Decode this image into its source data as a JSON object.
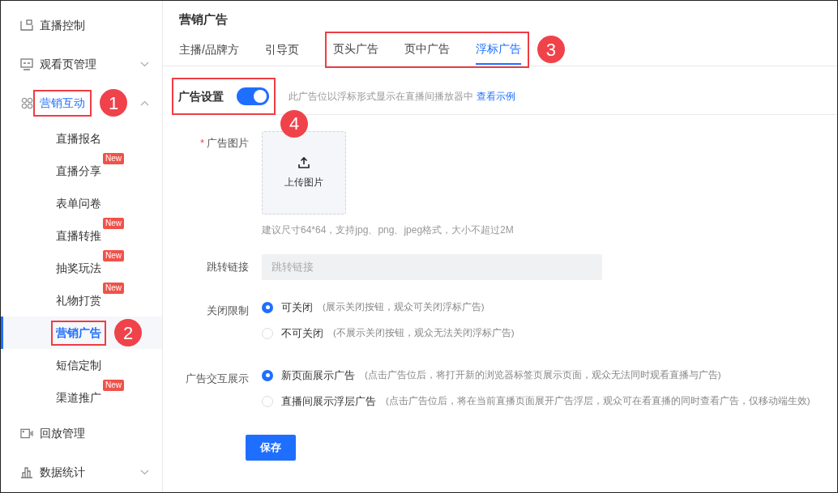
{
  "sidebar": {
    "items": [
      {
        "label": "直播控制",
        "selected": false
      },
      {
        "label": "观看页管理",
        "selected": false,
        "expanded": false
      },
      {
        "label": "营销互动",
        "selected": true,
        "expanded": true,
        "callout": "1",
        "children": [
          {
            "label": "直播报名",
            "selected": false
          },
          {
            "label": "直播分享",
            "selected": false,
            "badge": "New"
          },
          {
            "label": "表单问卷",
            "selected": false
          },
          {
            "label": "直播转推",
            "selected": false,
            "badge": "New"
          },
          {
            "label": "抽奖玩法",
            "selected": false,
            "badge": "New"
          },
          {
            "label": "礼物打赏",
            "selected": false,
            "badge": "New"
          },
          {
            "label": "营销广告",
            "selected": true,
            "callout": "2"
          },
          {
            "label": "短信定制",
            "selected": false
          },
          {
            "label": "渠道推广",
            "selected": false,
            "badge": "New"
          }
        ]
      },
      {
        "label": "回放管理",
        "selected": false
      },
      {
        "label": "数据统计",
        "selected": false,
        "expanded": false
      }
    ]
  },
  "page_title": "营销广告",
  "tabs": {
    "callout": "3",
    "items": [
      {
        "label": "主播/品牌方",
        "selected": false
      },
      {
        "label": "引导页",
        "selected": false
      },
      {
        "label": "页头广告",
        "selected": false,
        "boxed": true
      },
      {
        "label": "页中广告",
        "selected": false,
        "boxed": true
      },
      {
        "label": "浮标广告",
        "selected": true,
        "boxed": true
      }
    ]
  },
  "ad_setting": {
    "label": "广告设置",
    "on": true,
    "callout": "4",
    "description": "此广告位以浮标形式显示在直播间播放器中",
    "link": "查看示例"
  },
  "form": {
    "image": {
      "label": "广告图片",
      "required_mark": "*",
      "upload_label": "上传图片",
      "hint": "建议尺寸64*64，支持jpg、png、jpeg格式，大小不超过2M"
    },
    "link": {
      "label": "跳转链接",
      "placeholder": "跳转链接"
    },
    "close_limit": {
      "label": "关闭限制",
      "options": [
        {
          "label": "可关闭",
          "note": "(展示关闭按钮，观众可关闭浮标广告)",
          "selected": true
        },
        {
          "label": "不可关闭",
          "note": "(不展示关闭按钮，观众无法关闭浮标广告)",
          "selected": false
        }
      ]
    },
    "interaction": {
      "label": "广告交互展示",
      "options": [
        {
          "label": "新页面展示广告",
          "note": "(点击广告位后，将打开新的浏览器标签页展示页面，观众无法同时观看直播与广告)",
          "selected": true
        },
        {
          "label": "直播间展示浮层广告",
          "note": "(点击广告位后，将在当前直播页面展开广告浮层，观众可在看直播的同时查看广告，仅移动端生效)",
          "selected": false
        }
      ]
    },
    "save": "保存"
  }
}
